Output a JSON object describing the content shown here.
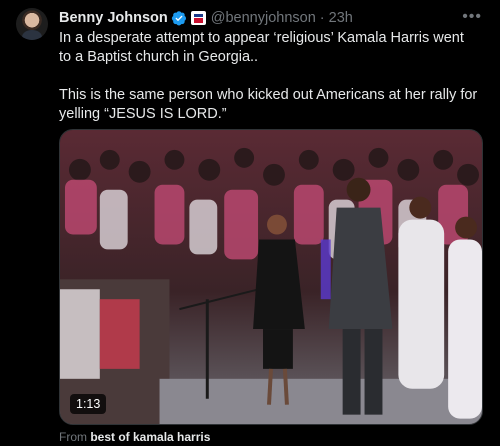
{
  "author": {
    "name": "Benny Johnson",
    "handle": "@bennyjohnson",
    "separator": "·",
    "time": "23h",
    "verified_icon": "verified-badge-icon",
    "affiliation_icon": "affiliate-flag-icon"
  },
  "more_icon": "more-icon",
  "tweet": {
    "line1": "In a desperate attempt to appear ‘religious’ Kamala Harris went to a Baptist church in Georgia..",
    "line2": "This is the same person who kicked out Americans at her rally for yelling “JESUS IS LORD.”"
  },
  "media": {
    "type": "video",
    "duration": "1:13"
  },
  "attribution": {
    "prefix": "From",
    "source": "best of kamala harris"
  },
  "colors": {
    "background": "#000000",
    "text": "#e7e9ea",
    "muted": "#71767b",
    "verified": "#1d9bf0"
  }
}
